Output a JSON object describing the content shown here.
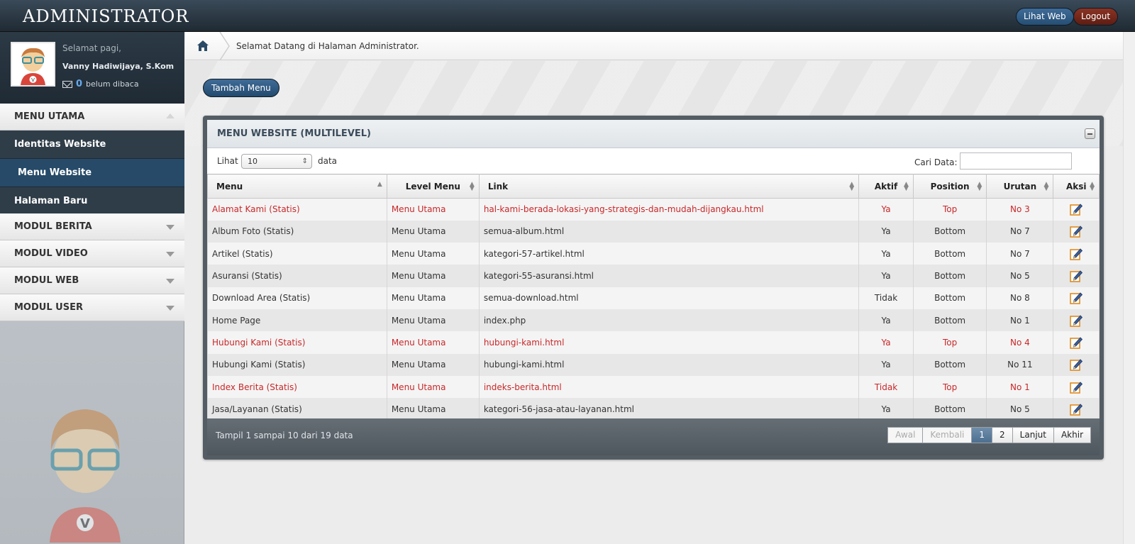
{
  "header": {
    "brand": "ADMINISTRATOR",
    "lihat_web": "Lihat Web",
    "logout": "Logout"
  },
  "user": {
    "greeting": "Selamat pagi,",
    "name": "Vanny Hadiwijaya, S.Kom",
    "unread_count": "0",
    "unread_label": "belum dibaca"
  },
  "sidebar": {
    "menu_utama": "MENU UTAMA",
    "items": [
      {
        "label": "Identitas Website"
      },
      {
        "label": "Menu Website"
      },
      {
        "label": "Halaman Baru"
      }
    ],
    "modul_berita": "MODUL BERITA",
    "modul_video": "MODUL VIDEO",
    "modul_web": "MODUL WEB",
    "modul_user": "MODUL USER"
  },
  "breadcrumb": {
    "text": "Selamat Datang di Halaman Administrator."
  },
  "main": {
    "add_button": "Tambah Menu"
  },
  "panel": {
    "title": "MENU WEBSITE (MULTILEVEL)",
    "lihat": "Lihat",
    "page_size": "10",
    "data_label": "data",
    "search_label": "Cari Data:",
    "search_value": "",
    "columns": [
      "Menu",
      "Level Menu",
      "Link",
      "Aktif",
      "Position",
      "Urutan",
      "Aksi"
    ],
    "rows": [
      {
        "menu": "Alamat Kami (Statis)",
        "level": "Menu Utama",
        "link": "hal-kami-berada-lokasi-yang-strategis-dan-mudah-dijangkau.html",
        "aktif": "Ya",
        "position": "Top",
        "urutan": "No 3"
      },
      {
        "menu": "Album Foto (Statis)",
        "level": "Menu Utama",
        "link": "semua-album.html",
        "aktif": "Ya",
        "position": "Bottom",
        "urutan": "No 7"
      },
      {
        "menu": "Artikel (Statis)",
        "level": "Menu Utama",
        "link": "kategori-57-artikel.html",
        "aktif": "Ya",
        "position": "Bottom",
        "urutan": "No 7"
      },
      {
        "menu": "Asuransi (Statis)",
        "level": "Menu Utama",
        "link": "kategori-55-asuransi.html",
        "aktif": "Ya",
        "position": "Bottom",
        "urutan": "No 5"
      },
      {
        "menu": "Download Area (Statis)",
        "level": "Menu Utama",
        "link": "semua-download.html",
        "aktif": "Tidak",
        "position": "Bottom",
        "urutan": "No 8"
      },
      {
        "menu": "Home Page",
        "level": "Menu Utama",
        "link": "index.php",
        "aktif": "Ya",
        "position": "Bottom",
        "urutan": "No 1"
      },
      {
        "menu": "Hubungi Kami (Statis)",
        "level": "Menu Utama",
        "link": "hubungi-kami.html",
        "aktif": "Ya",
        "position": "Top",
        "urutan": "No 4"
      },
      {
        "menu": "Hubungi Kami (Statis)",
        "level": "Menu Utama",
        "link": "hubungi-kami.html",
        "aktif": "Ya",
        "position": "Bottom",
        "urutan": "No 11"
      },
      {
        "menu": "Index Berita (Statis)",
        "level": "Menu Utama",
        "link": "indeks-berita.html",
        "aktif": "Tidak",
        "position": "Top",
        "urutan": "No 1"
      },
      {
        "menu": "Jasa/Layanan (Statis)",
        "level": "Menu Utama",
        "link": "kategori-56-jasa-atau-layanan.html",
        "aktif": "Ya",
        "position": "Bottom",
        "urutan": "No 5"
      }
    ],
    "footer_text": "Tampil 1 sampai 10 dari 19 data",
    "pager": [
      "Awal",
      "Kembali",
      "1",
      "2",
      "Lanjut",
      "Akhir"
    ]
  },
  "colors": {
    "highlight_red": "#c8282a",
    "accent_blue": "#264a68"
  }
}
